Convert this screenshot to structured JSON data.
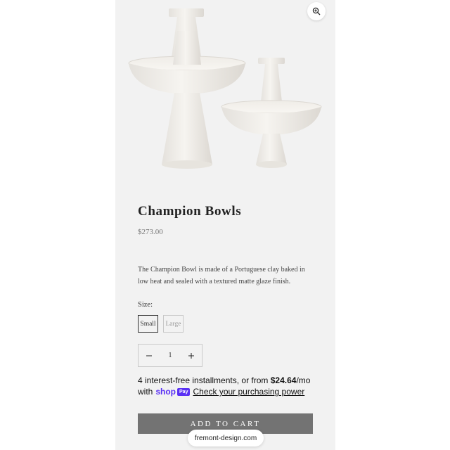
{
  "product": {
    "title": "Champion Bowls",
    "price": "$273.00",
    "description": "The Champion Bowl is made of a Portuguese clay baked in low heat and sealed with a textured matte glaze finish.",
    "image_alt": "Two white Champion Bowls on pedestals"
  },
  "size": {
    "label": "Size:",
    "options": [
      "Small",
      "Large"
    ],
    "selected": "Small"
  },
  "quantity": {
    "value": "1",
    "decrement_icon": "minus-icon",
    "increment_icon": "plus-icon"
  },
  "installments": {
    "text_before": "4 interest-free installments, or from ",
    "amount": "$24.64",
    "text_after": "/mo",
    "with": "with",
    "shop": "shop",
    "pay": "Pay",
    "link": "Check your purchasing power"
  },
  "cart": {
    "add_label": "ADD TO CART"
  },
  "browser": {
    "domain": "fremont-design.com"
  },
  "icons": {
    "zoom": "zoom-in-icon"
  },
  "colors": {
    "background": "#f2f2f2",
    "button": "#737373",
    "shoppay": "#5a31f4"
  }
}
